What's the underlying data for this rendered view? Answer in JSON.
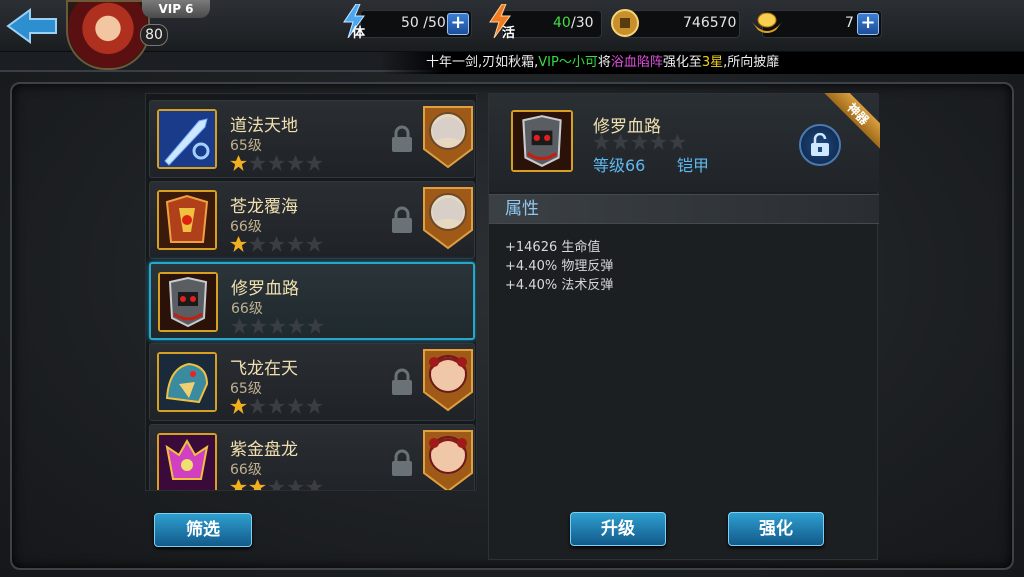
{
  "player": {
    "vip": "VIP 6",
    "level": "80"
  },
  "resources": {
    "stamina_tag": "体",
    "stamina": "50 /50",
    "energy_tag": "活",
    "energy_current": "40",
    "energy_max": "/30",
    "coins": "746570",
    "gold": "7"
  },
  "marquee": {
    "part1": "十年一剑,刃如秋霜,",
    "vip_name": "VIP～小可",
    "part2": "将",
    "item": "浴血陷阵",
    "part3": "强化至",
    "stars": "3星",
    "part4": ",所向披靡"
  },
  "equipment_list": [
    {
      "name": "道法天地",
      "level": "65级",
      "stars": 1,
      "locked": true,
      "icon": "sword-icon",
      "hero": "white-hair-hero"
    },
    {
      "name": "苍龙覆海",
      "level": "66级",
      "stars": 1,
      "locked": true,
      "icon": "dragon-armor-icon",
      "hero": "white-hair-hero"
    },
    {
      "name": "修罗血路",
      "level": "66级",
      "stars": 0,
      "locked": false,
      "icon": "skull-armor-icon",
      "hero": ""
    },
    {
      "name": "飞龙在天",
      "level": "65级",
      "stars": 1,
      "locked": true,
      "icon": "dragon-beast-icon",
      "hero": "red-hair-heroine"
    },
    {
      "name": "紫金盘龙",
      "level": "66级",
      "stars": 2,
      "locked": true,
      "icon": "purple-dragon-icon",
      "hero": "red-hair-heroine"
    }
  ],
  "detail": {
    "name": "修罗血路",
    "level": "等级66",
    "type": "铠甲",
    "ribbon": "神器",
    "attr_header": "属性",
    "attributes": [
      "+14626 生命值",
      "+4.40% 物理反弹",
      "+4.40% 法术反弹"
    ]
  },
  "buttons": {
    "filter": "筛选",
    "upgrade": "升级",
    "enhance": "强化"
  },
  "colors": {
    "accent_blue": "#2e9fd0",
    "gold_border": "#d8a020",
    "star_gold": "#f0b020"
  }
}
